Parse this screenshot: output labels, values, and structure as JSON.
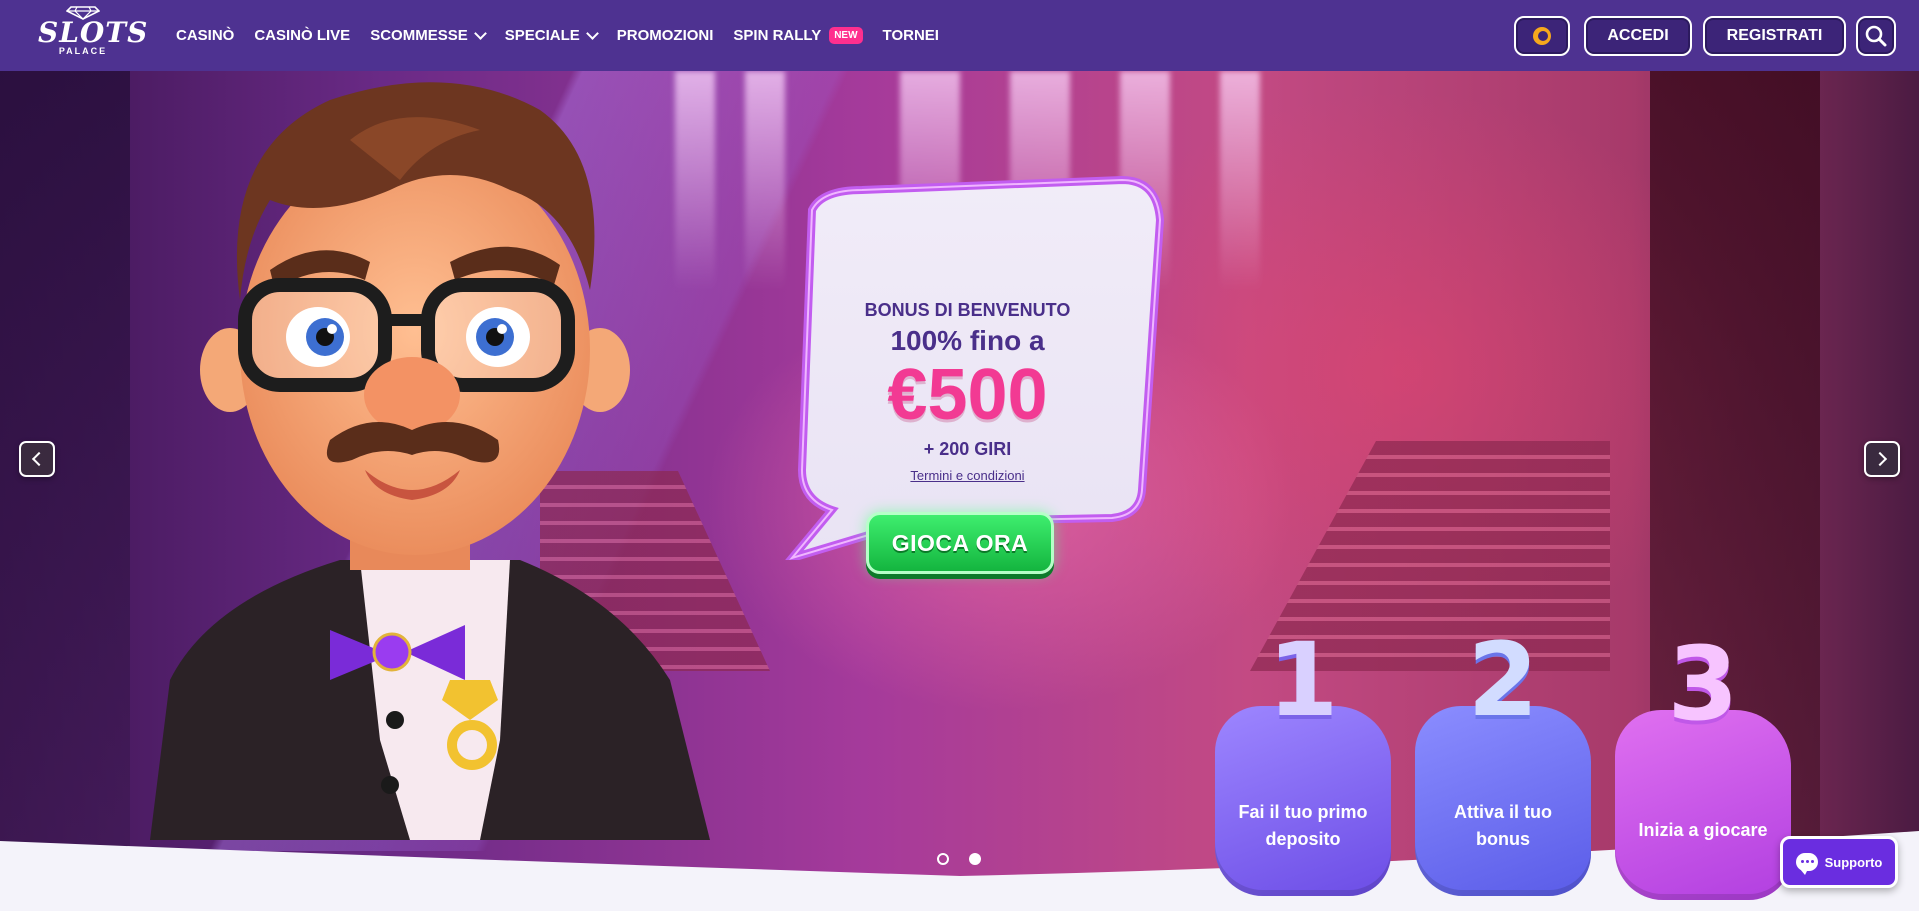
{
  "header": {
    "logo": {
      "word": "SLOTS",
      "sub": "PALACE"
    },
    "nav": [
      {
        "label": "CASINÒ",
        "name": "nav-casino",
        "dropdown": false
      },
      {
        "label": "CASINÒ LIVE",
        "name": "nav-casino-live",
        "dropdown": false
      },
      {
        "label": "SCOMMESSE",
        "name": "nav-scommesse",
        "dropdown": true
      },
      {
        "label": "SPECIALE",
        "name": "nav-speciale",
        "dropdown": true
      },
      {
        "label": "PROMOZIONI",
        "name": "nav-promozioni",
        "dropdown": false
      },
      {
        "label": "SPIN RALLY",
        "name": "nav-spin-rally",
        "dropdown": false,
        "badge": "NEW"
      },
      {
        "label": "TORNEI",
        "name": "nav-tornei",
        "dropdown": false
      }
    ],
    "login_label": "ACCEDI",
    "register_label": "REGISTRATI"
  },
  "hero": {
    "bonus_title": "BONUS DI BENVENUTO",
    "bonus_line": "100% fino a",
    "bonus_amount": "€500",
    "bonus_spins": "+ 200 GIRI",
    "terms_label": "Termini e condizioni",
    "cta_label": "GIOCA ORA",
    "steps": [
      {
        "number": "1",
        "text": "Fai il tuo primo deposito"
      },
      {
        "number": "2",
        "text": "Attiva il tuo bonus"
      },
      {
        "number": "3",
        "text": "Inizia a giocare"
      }
    ],
    "slide_count": 2,
    "active_slide": 2
  },
  "support_label": "Supporto",
  "colors": {
    "header_bg": "#4e3291",
    "accent_pink": "#f23a93",
    "cta_green": "#1fcf4f",
    "badge_new": "#ff2f8e",
    "support_bg": "#6a2de0"
  },
  "icons": [
    "diamond-logo-icon",
    "chevron-down-icon",
    "coin-icon",
    "search-icon",
    "chevron-left-icon",
    "chevron-right-icon",
    "chat-bubble-icon"
  ]
}
